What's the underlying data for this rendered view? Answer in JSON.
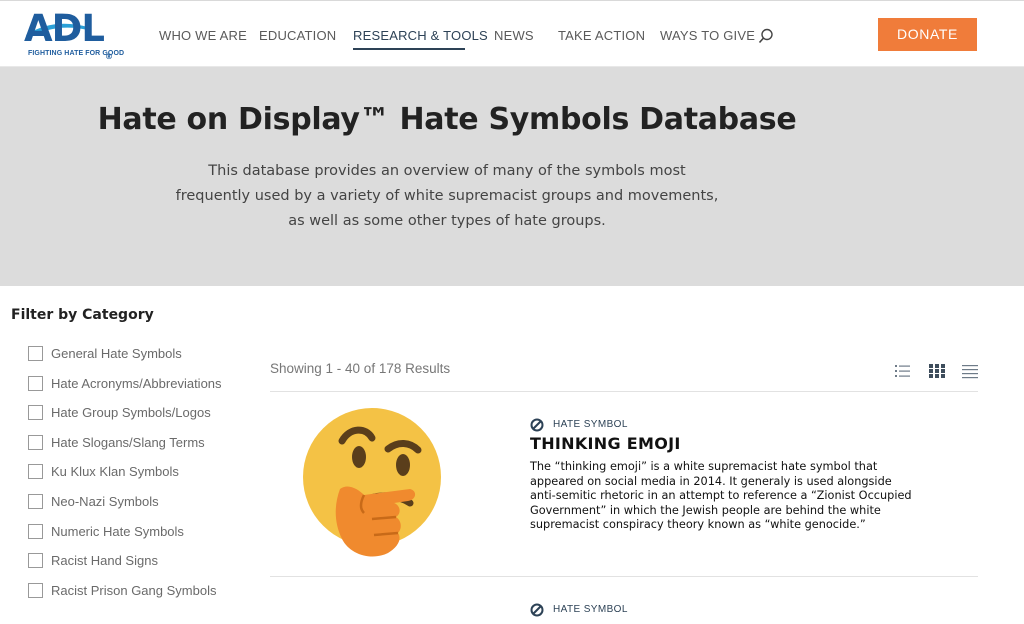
{
  "header": {
    "logo_text": "ADL",
    "logo_tagline": "FIGHTING HATE FOR GOOD",
    "nav": [
      {
        "label": "WHO WE ARE"
      },
      {
        "label": "EDUCATION"
      },
      {
        "label": "RESEARCH & TOOLS",
        "active": true
      },
      {
        "label": "NEWS"
      },
      {
        "label": "TAKE ACTION"
      },
      {
        "label": "WAYS TO GIVE"
      }
    ],
    "donate_label": "DONATE",
    "colors": {
      "brand": "#1f5d9e",
      "donate": "#f07c3a",
      "nav_active": "#2d4256"
    }
  },
  "hero": {
    "title": "Hate on Display™ Hate Symbols Database",
    "description": "This database provides an overview of many of the symbols most frequently used by a variety of white supremacist groups and movements, as well as some other types of hate groups.",
    "background": "#dcdcdc"
  },
  "filter": {
    "title": "Filter by Category",
    "categories": [
      {
        "label": "General Hate Symbols",
        "checked": false
      },
      {
        "label": "Hate Acronyms/Abbreviations",
        "checked": false
      },
      {
        "label": "Hate Group Symbols/Logos",
        "checked": false
      },
      {
        "label": "Hate Slogans/Slang Terms",
        "checked": false
      },
      {
        "label": "Ku Klux Klan Symbols",
        "checked": false
      },
      {
        "label": "Neo-Nazi Symbols",
        "checked": false
      },
      {
        "label": "Numeric Hate Symbols",
        "checked": false
      },
      {
        "label": "Racist Hand Signs",
        "checked": false
      },
      {
        "label": "Racist Prison Gang Symbols",
        "checked": false
      }
    ]
  },
  "results": {
    "count_text": "Showing 1 - 40 of 178 Results",
    "view_modes": [
      "list-view-icon",
      "grid-view-icon",
      "compact-view-icon"
    ],
    "cards": [
      {
        "badge": "HATE SYMBOL",
        "title": "THINKING EMOJI",
        "description_lines": [
          "The “thinking emoji” is a white supremacist hate symbol that",
          "appeared on social media in 2014. It generaly is used alongside",
          "anti-semitic rhetoric in an attempt to reference a “Zionist Occupied",
          "Government” in which the Jewish people are behind the white",
          "supremacist conspiracy theory known as “white genocide.”"
        ],
        "image_icon": "thinking-face-emoji"
      },
      {
        "badge": "HATE SYMBOL"
      }
    ]
  }
}
